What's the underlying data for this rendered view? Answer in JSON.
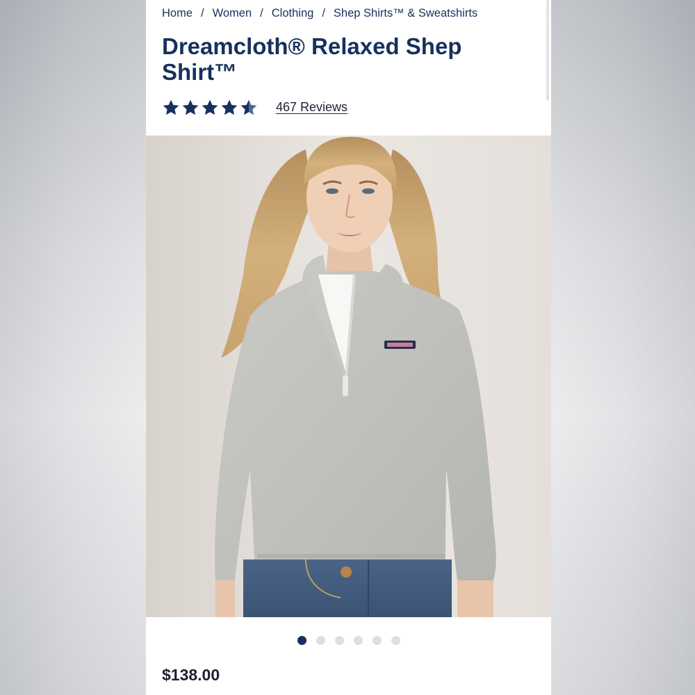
{
  "breadcrumb": {
    "items": [
      "Home",
      "Women",
      "Clothing",
      "Shep Shirts™ & Sweatshirts"
    ],
    "separator": "/"
  },
  "product": {
    "title": "Dreamcloth® Relaxed Shep Shirt™",
    "rating": 4.5,
    "rating_max": 5,
    "reviews_label": "467 Reviews",
    "price": "$138.00"
  },
  "gallery": {
    "image_count": 6,
    "active_index": 0
  },
  "colors": {
    "brand_navy": "#17315e",
    "dot_inactive": "#dedede"
  },
  "icons": {
    "star": "star-icon",
    "half_star": "star-half-icon",
    "dot": "carousel-dot"
  }
}
